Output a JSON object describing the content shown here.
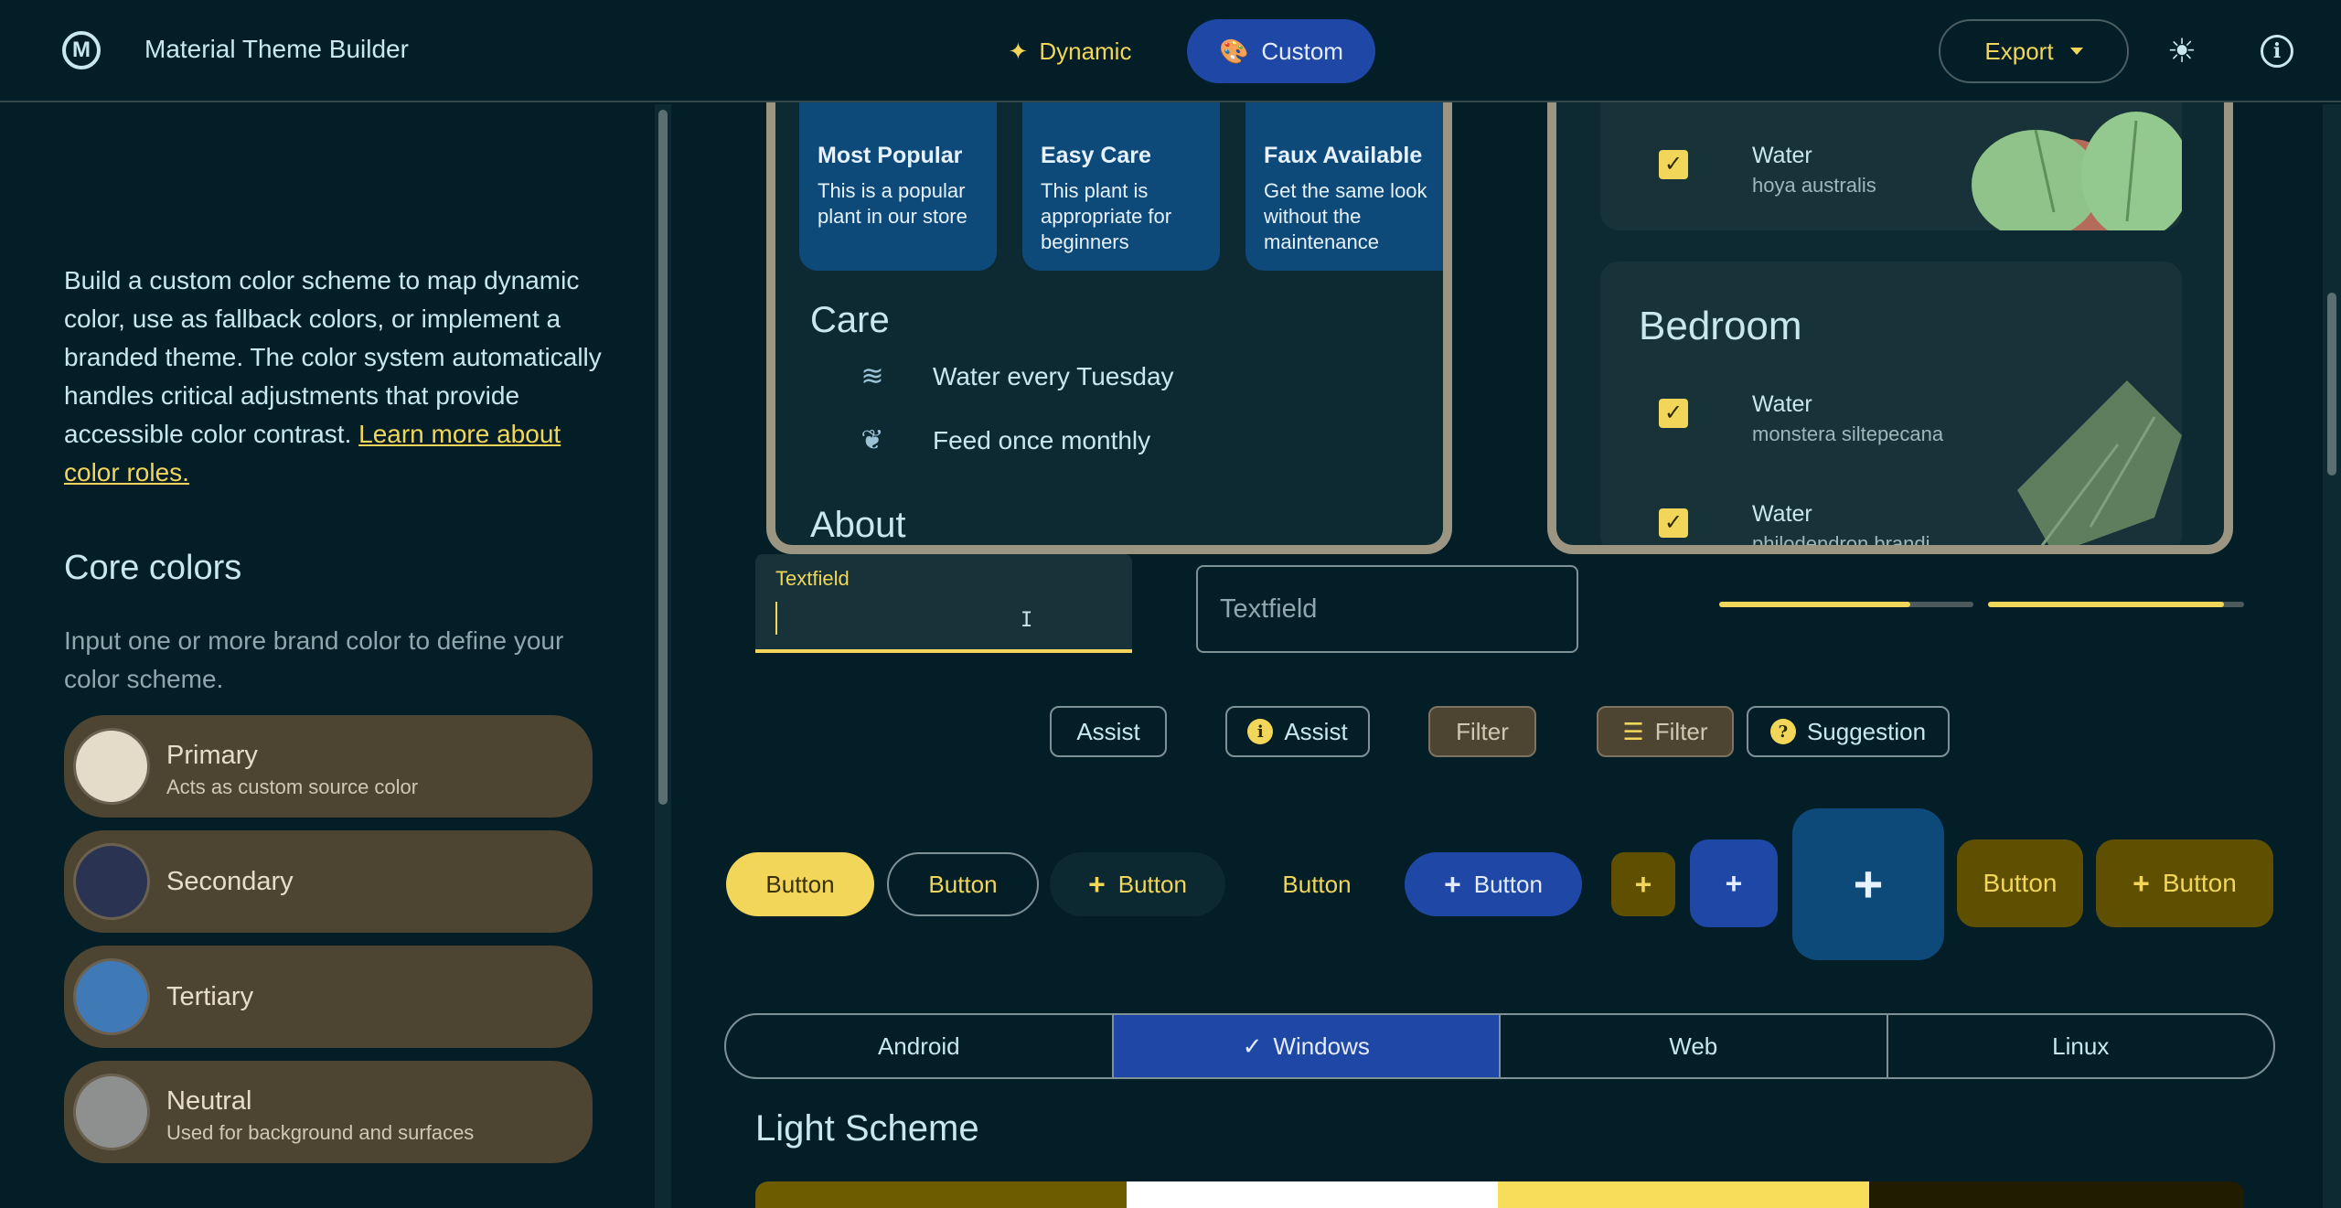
{
  "app": {
    "title": "Material Theme Builder",
    "logo_letter": "M"
  },
  "modes": {
    "dynamic_label": "Dynamic",
    "custom_label": "Custom",
    "active": "Custom"
  },
  "toolbar": {
    "export_label": "Export"
  },
  "sidebar": {
    "intro": "Build a custom color scheme to map dynamic color, use as fallback colors, or implement a branded theme. The color system automatically handles critical adjustments that provide accessible color contrast.",
    "intro_link": "Learn more about color roles.",
    "core_title": "Core colors",
    "core_desc": "Input one or more brand color to define your color scheme.",
    "colors": [
      {
        "name": "Primary",
        "sub": "Acts as custom source color",
        "hex": "#e4dcc8"
      },
      {
        "name": "Secondary",
        "sub": "",
        "hex": "#2b3352"
      },
      {
        "name": "Tertiary",
        "sub": "",
        "hex": "#3f7ab6"
      },
      {
        "name": "Neutral",
        "sub": "Used for background and surfaces",
        "hex": "#8e9090"
      }
    ]
  },
  "preview": {
    "plant_cards": [
      {
        "title": "Most Popular",
        "desc": "This is a popular plant in our store"
      },
      {
        "title": "Easy Care",
        "desc": "This plant is appropriate for beginners"
      },
      {
        "title": "Faux Available",
        "desc": "Get the same look without the maintenance"
      }
    ],
    "care_title": "Care",
    "care_items": [
      "Water every Tuesday",
      "Feed once monthly"
    ],
    "about_title": "About",
    "rooms": {
      "top_item": {
        "name": "Water",
        "sub": "hoya australis"
      },
      "bedroom_title": "Bedroom",
      "bedroom_items": [
        {
          "name": "Water",
          "sub": "monstera siltepecana"
        },
        {
          "name": "Water",
          "sub": "philodendron brandi"
        }
      ]
    }
  },
  "fields": {
    "filled_label": "Textfield",
    "outlined_placeholder": "Textfield"
  },
  "progress": [
    0.75,
    0.92
  ],
  "chips": {
    "assist1": "Assist",
    "assist2": "Assist",
    "filter1": "Filter",
    "filter2": "Filter",
    "suggestion": "Suggestion"
  },
  "buttons": {
    "filled": "Button",
    "outlined": "Button",
    "elevated": "Button",
    "text": "Button",
    "tonal": "Button",
    "ext1": "Button",
    "ext2": "Button"
  },
  "segments": {
    "items": [
      "Android",
      "Windows",
      "Web",
      "Linux"
    ],
    "active": "Windows"
  },
  "scheme": {
    "title": "Light Scheme",
    "colors": [
      "#6d5d00",
      "#ffffff",
      "#f8dd5a",
      "#211b00"
    ]
  },
  "colors": {
    "accent": "#f1d65a",
    "background": "#031e27",
    "primary_container": "#1f47a6"
  }
}
